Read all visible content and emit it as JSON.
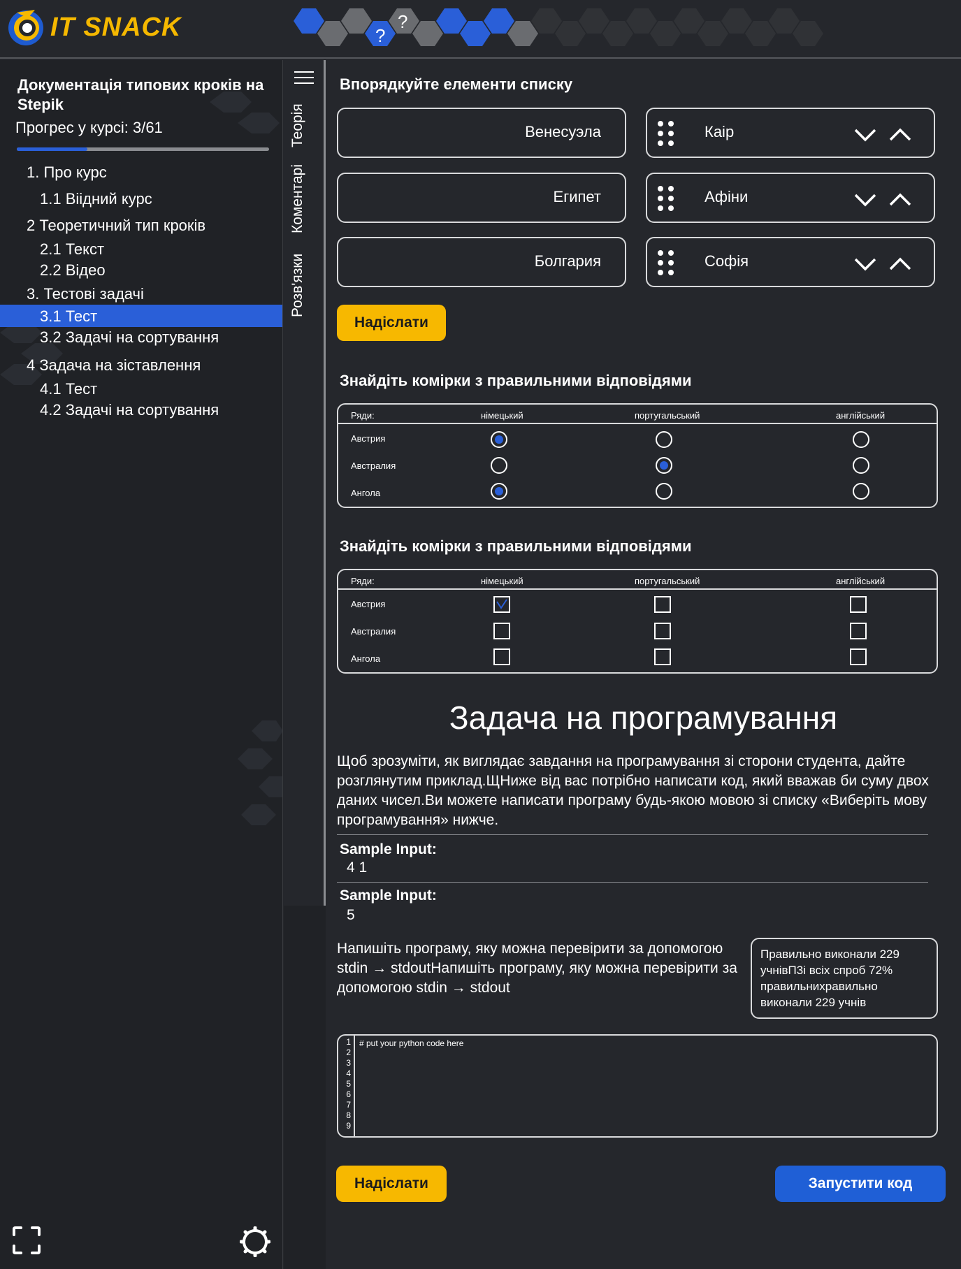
{
  "brand": {
    "name": "IT SNACK",
    "accent": "#f5b800",
    "blue": "#2a5fd8"
  },
  "header": {
    "hex_question_marks": [
      "?",
      "?"
    ]
  },
  "sidebar": {
    "course_title": "Документація типових кроків на Stepik",
    "progress_label": "Прогрес у курсі:  3/61",
    "progress_fraction": 0.28,
    "items": [
      {
        "label": "1. Про курс",
        "level": 0,
        "active": false
      },
      {
        "label": "1.1 Віідний курс",
        "level": 1,
        "active": false
      },
      {
        "label": "2 Теоретичний тип кроків",
        "level": 0,
        "active": false
      },
      {
        "label": "2.1 Текст",
        "level": 1,
        "active": false
      },
      {
        "label": "2.2 Відео",
        "level": 1,
        "active": false
      },
      {
        "label": "3. Тестові задачі",
        "level": 0,
        "active": false
      },
      {
        "label": "3.1 Тест",
        "level": 1,
        "active": true
      },
      {
        "label": "3.2 Задачі на сортування",
        "level": 1,
        "active": false
      },
      {
        "label": "4 Задача на зіставлення",
        "level": 0,
        "active": false
      },
      {
        "label": "4.1 Тест",
        "level": 1,
        "active": false
      },
      {
        "label": "4.2 Задачі на сортування",
        "level": 1,
        "active": false
      }
    ],
    "bottom_icons": [
      "fullscreen-icon",
      "settings-icon"
    ]
  },
  "vertical_tabs": [
    "Теорія",
    "Коментарі",
    "Розв'язки"
  ],
  "ordering": {
    "title": "Впорядкуйте елементи списку",
    "left": [
      "Венесуэла",
      "Египет",
      "Болгария"
    ],
    "right": [
      "Каір",
      "Афіни",
      "Софія"
    ],
    "submit": "Надіслати"
  },
  "radio_grid": {
    "title": "Знайдіть комірки з правильними відповідями",
    "header": [
      "Ряди:",
      "німецький",
      "португальський",
      "англійський"
    ],
    "rows": [
      "Австрия",
      "Австралия",
      "Ангола"
    ],
    "selected": [
      [
        true,
        false,
        false
      ],
      [
        false,
        true,
        false
      ],
      [
        true,
        false,
        false
      ]
    ]
  },
  "check_grid": {
    "title": "Знайдіть комірки з правильними відповідями",
    "header": [
      "Ряди:",
      "німецький",
      "португальський",
      "англійський"
    ],
    "rows": [
      "Австрия",
      "Австралия",
      "Ангола"
    ],
    "checked": [
      [
        true,
        false,
        false
      ],
      [
        false,
        false,
        false
      ],
      [
        false,
        false,
        false
      ]
    ]
  },
  "programming": {
    "title": "Задача на програмування",
    "description": "Щоб зрозуміти, як виглядає завдання на програмування зі сторони студента, дайте розглянутим приклад.ЩНиже від вас потрібно написати код, який вважав би суму двох даних чисел.Ви можете написати програму будь-якою мовою зі списку «Виберіть мову програмування» нижче.",
    "sample1_label": "Sample Input:",
    "sample1_value": "4 1",
    "sample2_label": "Sample Input:",
    "sample2_value": "5",
    "task": "Напишіть програму, яку можна перевірити за допомогою stdin → stdoutНапишіть програму, яку можна перевірити за допомогою stdin → stdout",
    "stats": "Правильно виконали 229 учнівП3і всіх спроб 72% правильнихравильно виконали 229 учнів",
    "code_line": "# put your python code here",
    "line_numbers": [
      "1",
      "2",
      "3",
      "4",
      "5",
      "6",
      "7",
      "8",
      "9"
    ],
    "submit": "Надіслати",
    "run": "Запустити код"
  }
}
